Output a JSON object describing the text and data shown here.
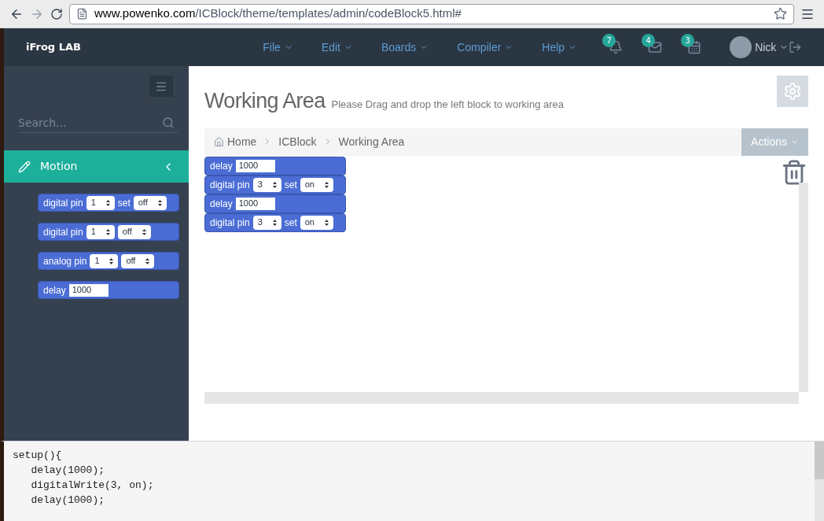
{
  "browser": {
    "url_host": "www.powenko.com",
    "url_path": "/ICBlock/theme/templates/admin/codeBlock5.html#"
  },
  "nav": {
    "logo": "iFrog LAB",
    "menus": [
      "File",
      "Edit",
      "Boards",
      "Compiler",
      "Help"
    ],
    "badges": [
      {
        "kind": "bell",
        "count": "7"
      },
      {
        "kind": "mail",
        "count": "4"
      },
      {
        "kind": "calendar",
        "count": "3"
      }
    ],
    "user": "Nick"
  },
  "sidebar": {
    "search": {
      "placeholder": "Search..."
    },
    "section": {
      "label": "Motion",
      "expanded": true
    },
    "blocks": [
      {
        "kind": "pin",
        "label": "digital pin",
        "pin": "1",
        "connector": "set",
        "state": "off"
      },
      {
        "kind": "pin",
        "label": "digital pin",
        "pin": "1",
        "state": "off"
      },
      {
        "kind": "pin",
        "label": "analog pin",
        "pin": "1",
        "state": "off"
      },
      {
        "kind": "delay",
        "label": "delay",
        "value": "1000"
      }
    ]
  },
  "page": {
    "title": "Working Area",
    "subtitle": "Please Drag and drop the left block to working area",
    "breadcrumb": [
      "Home",
      "ICBlock",
      "Working Area"
    ],
    "actions": "Actions"
  },
  "workspace": {
    "blocks": [
      {
        "kind": "delay",
        "label": "delay",
        "value": "1000"
      },
      {
        "kind": "pin",
        "label": "digital pin",
        "pin": "3",
        "connector": "set",
        "state": "on"
      },
      {
        "kind": "delay",
        "label": "delay",
        "value": "1000"
      },
      {
        "kind": "pin",
        "label": "digital pin",
        "pin": "3",
        "connector": "set",
        "state": "on"
      }
    ]
  },
  "code": [
    "setup(){",
    "   delay(1000);",
    "   digitalWrite(3, on);",
    "   delay(1000);"
  ]
}
